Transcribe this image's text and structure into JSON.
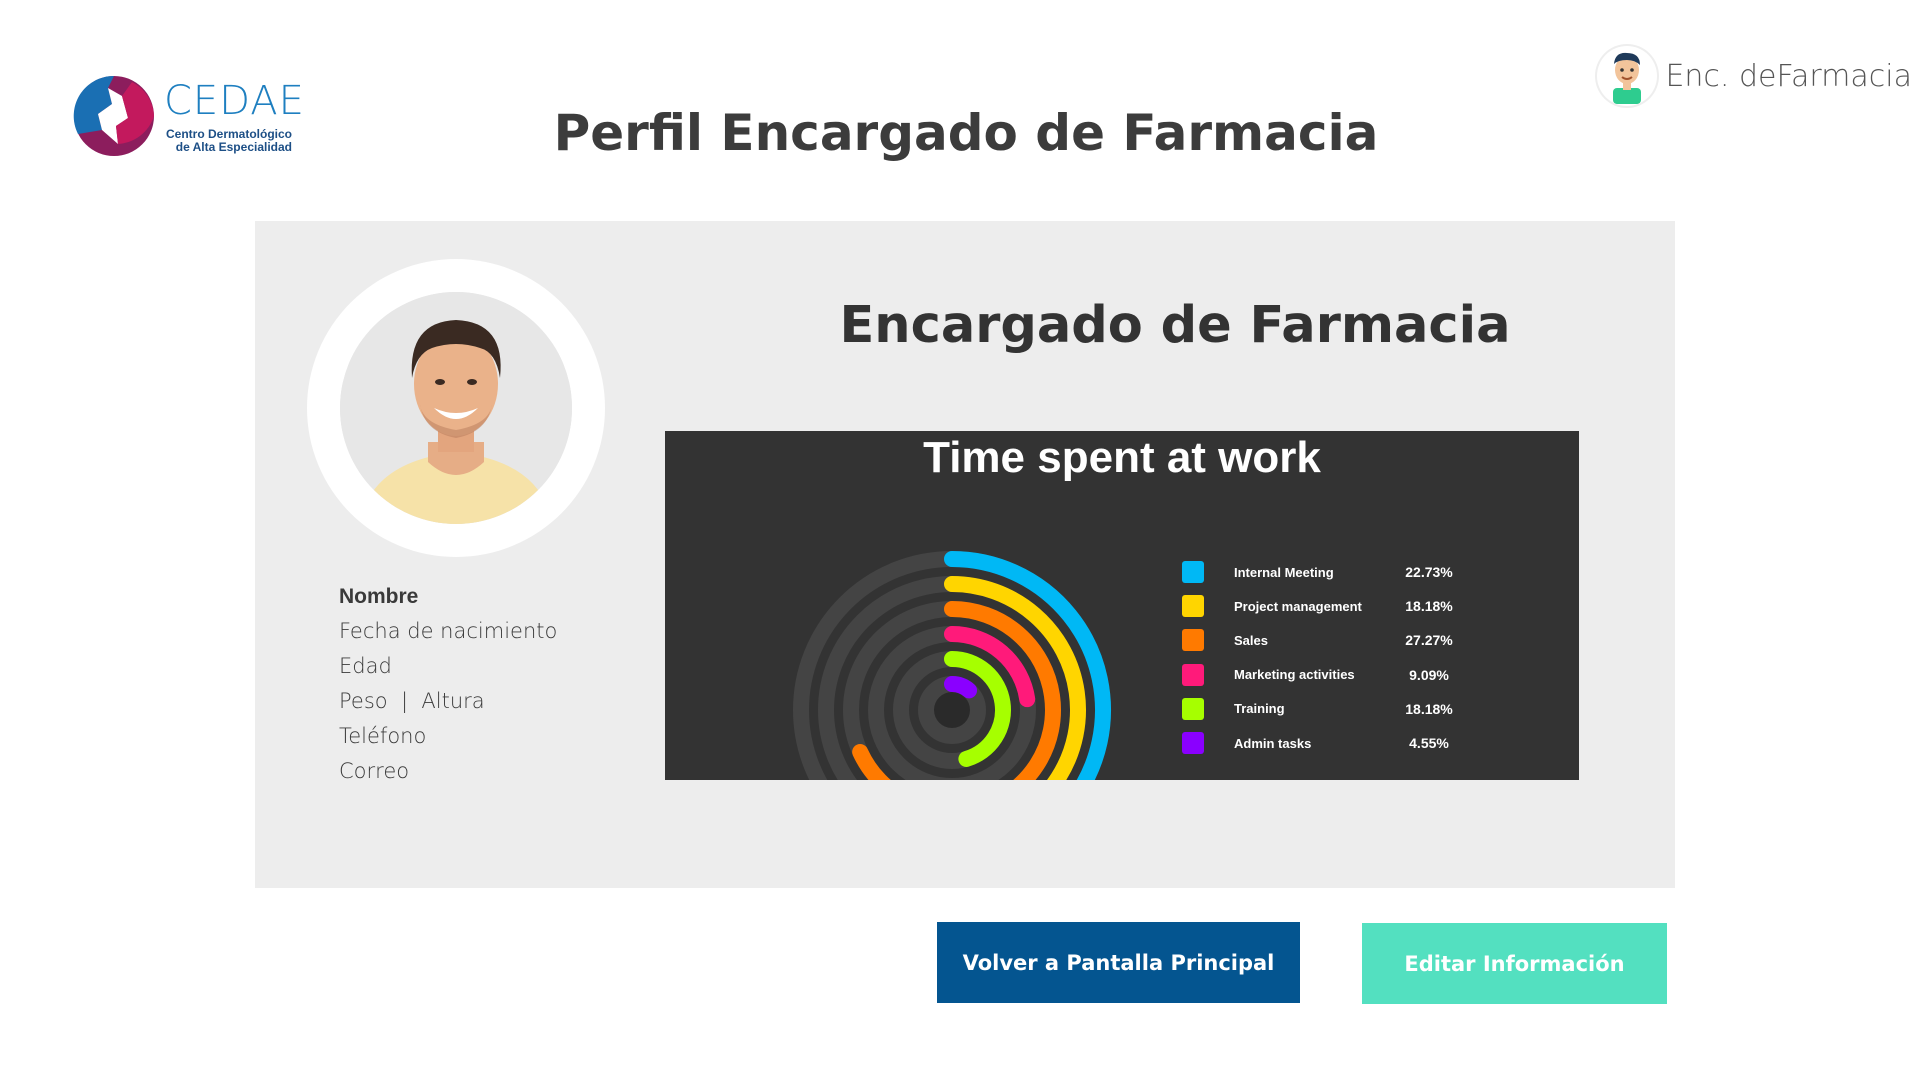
{
  "logo": {
    "name": "CEDAE",
    "tagline_line1": "Centro Dermatológico",
    "tagline_line2": "de Alta Especialidad"
  },
  "user": {
    "name": "Enc. deFarmacia",
    "avatar_icon": "user-avatar-icon"
  },
  "page": {
    "title": "Perfil Encargado de Farmacia"
  },
  "profile": {
    "role_title": "Encargado de Farmacia",
    "photo_icon": "person-photo",
    "fields": [
      {
        "label": "Nombre"
      },
      {
        "label": "Fecha de nacimiento"
      },
      {
        "label": "Edad"
      },
      {
        "label": "Peso  |  Altura"
      },
      {
        "label": "Teléfono"
      },
      {
        "label": "Correo"
      }
    ]
  },
  "buttons": {
    "back_label": "Volver a Pantalla Principal",
    "edit_label": "Editar Información"
  },
  "colors": {
    "back_button": "#045590",
    "edit_button": "#53e0c0",
    "chart_background": "#333333",
    "card_background": "#ededed"
  },
  "chart_data": {
    "type": "radial-bar",
    "title": "Time spent at work",
    "legend_position": "right",
    "series": [
      {
        "name": "Internal Meeting",
        "value": 22.73,
        "label": "22.73%",
        "color": "#00b8f5"
      },
      {
        "name": "Project management",
        "value": 18.18,
        "label": "18.18%",
        "color": "#ffd500"
      },
      {
        "name": "Sales",
        "value": 27.27,
        "label": "27.27%",
        "color": "#ff7a00"
      },
      {
        "name": "Marketing activities",
        "value": 9.09,
        "label": "9.09%",
        "color": "#ff1a7a"
      },
      {
        "name": "Training",
        "value": 18.18,
        "label": "18.18%",
        "color": "#a6ff00"
      },
      {
        "name": "Admin tasks",
        "value": 4.55,
        "label": "4.55%",
        "color": "#8a00ff"
      }
    ]
  }
}
